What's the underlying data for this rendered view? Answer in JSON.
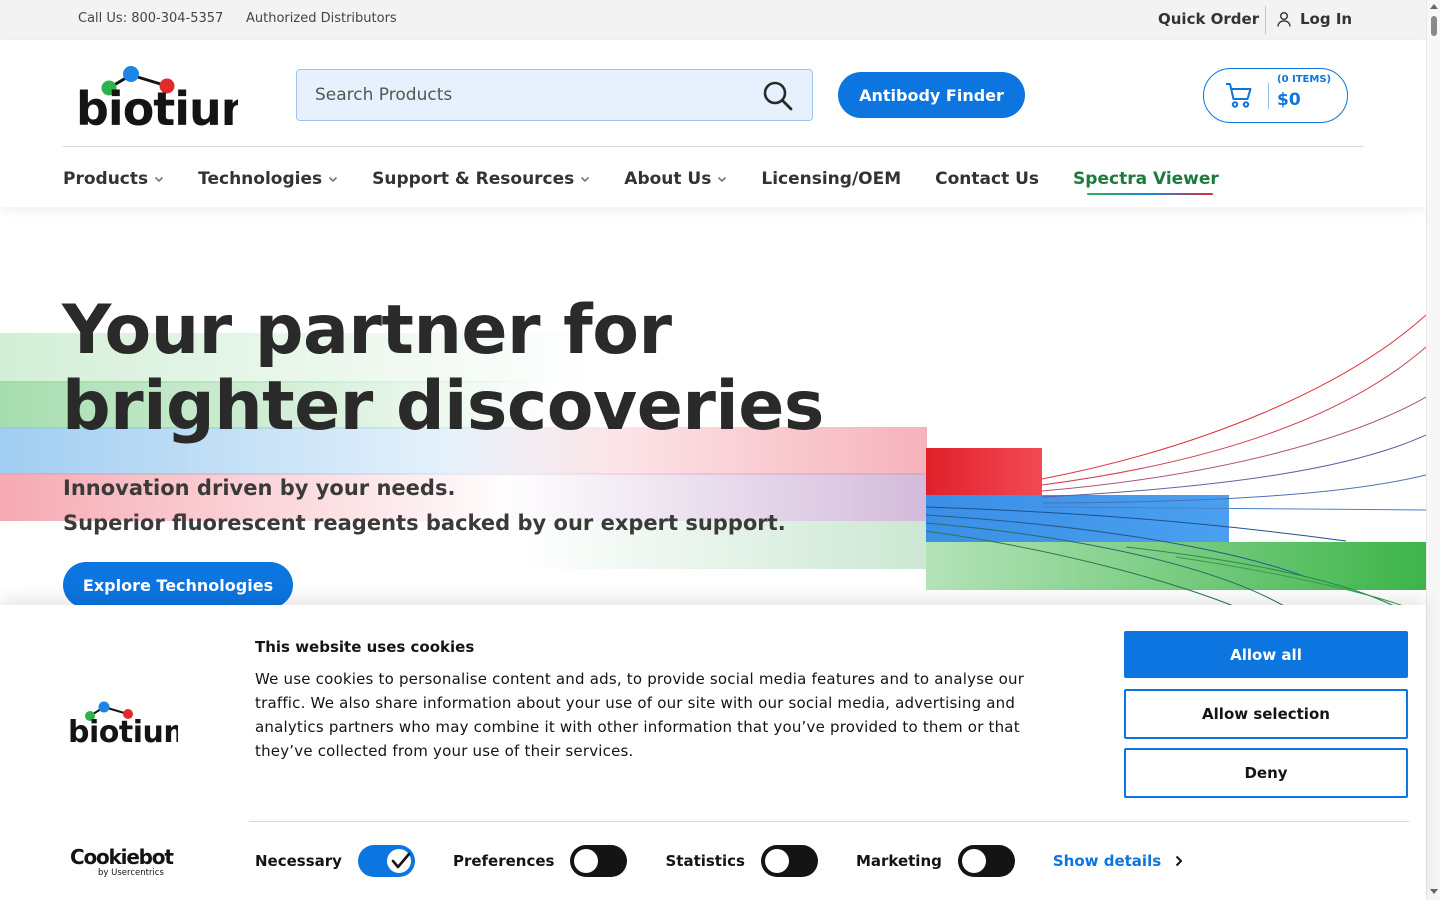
{
  "utility": {
    "call": "Call Us: 800-304-5357",
    "distributors": "Authorized Distributors",
    "quick_order": "Quick Order",
    "login": "Log In"
  },
  "header": {
    "logo": "biotium",
    "search_placeholder": "Search Products",
    "antibody_finder": "Antibody Finder",
    "cart_items": "(0 ITEMS)",
    "cart_total": "$0"
  },
  "nav": {
    "items": [
      {
        "label": "Products",
        "dropdown": true
      },
      {
        "label": "Technologies",
        "dropdown": true
      },
      {
        "label": "Support & Resources",
        "dropdown": true
      },
      {
        "label": "About Us",
        "dropdown": true
      },
      {
        "label": "Licensing/OEM",
        "dropdown": false
      },
      {
        "label": "Contact Us",
        "dropdown": false
      },
      {
        "label": "Spectra Viewer",
        "dropdown": false
      }
    ]
  },
  "hero": {
    "headline_line1": "Your partner for",
    "headline_line2": "brighter discoveries",
    "sub_line1": "Innovation driven by your needs.",
    "sub_line2": "Superior fluorescent reagents backed by our expert support.",
    "cta": "Explore Technologies"
  },
  "cookie": {
    "title": "This website uses cookies",
    "text": "We use cookies to personalise content and ads, to provide social media features and to analyse our traffic. We also share information about your use of our site with our social media, advertising and analytics partners who may combine it with other information that you’ve provided to them or that they’ve collected from your use of their services.",
    "allow_all": "Allow all",
    "allow_selection": "Allow selection",
    "deny": "Deny",
    "provider": "Cookiebot",
    "provider_sub": "by Usercentrics",
    "toggles": [
      {
        "label": "Necessary",
        "on": true
      },
      {
        "label": "Preferences",
        "on": false
      },
      {
        "label": "Statistics",
        "on": false
      },
      {
        "label": "Marketing",
        "on": false
      }
    ],
    "show_details": "Show details"
  },
  "colors": {
    "brand_blue": "#0c75e0",
    "logo_green": "#2db34a",
    "logo_blue": "#1b86e3",
    "logo_red": "#e02b2b",
    "spectra_green": "#1c7a3d"
  }
}
